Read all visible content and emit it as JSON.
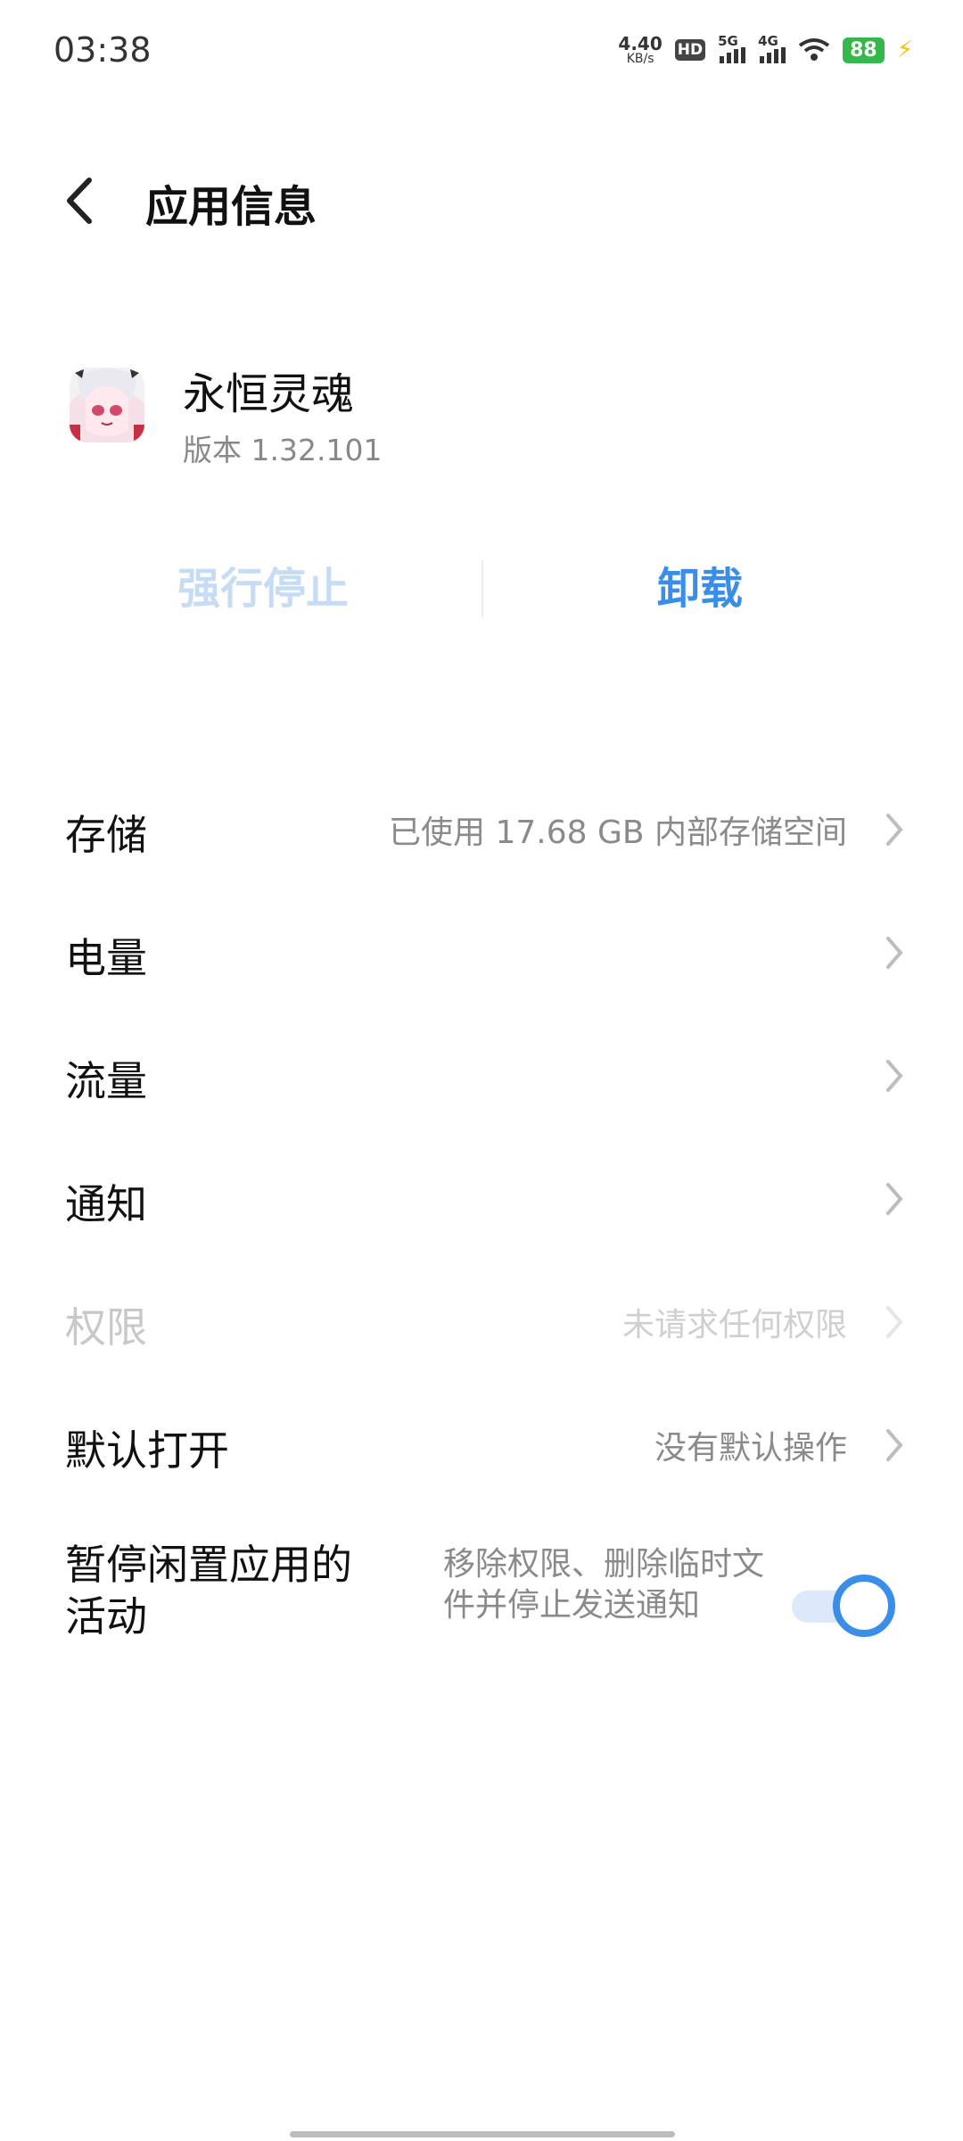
{
  "status_bar": {
    "time": "03:38",
    "net_speed_value": "4.40",
    "net_speed_unit": "KB/s",
    "hd_label": "HD",
    "sim1_tag": "5G",
    "sim2_tag": "4G",
    "battery": "88"
  },
  "header": {
    "title": "应用信息"
  },
  "app": {
    "name": "永恒灵魂",
    "version": "版本 1.32.101"
  },
  "actions": {
    "force_stop": "强行停止",
    "uninstall": "卸载"
  },
  "rows": [
    {
      "label": "存储",
      "value": "已使用 17.68 GB 内部存储空间"
    },
    {
      "label": "电量",
      "value": ""
    },
    {
      "label": "流量",
      "value": ""
    },
    {
      "label": "通知",
      "value": ""
    },
    {
      "label": "权限",
      "value": "未请求任何权限"
    },
    {
      "label": "默认打开",
      "value": "没有默认操作"
    }
  ],
  "idle_setting": {
    "label": "暂停闲置应用的活动",
    "description": "移除权限、删除临时文件并停止发送通知",
    "enabled": true
  },
  "colors": {
    "accent": "#3b8ee8",
    "battery": "#33b84a",
    "disabled_text": "#c6dcf5"
  }
}
